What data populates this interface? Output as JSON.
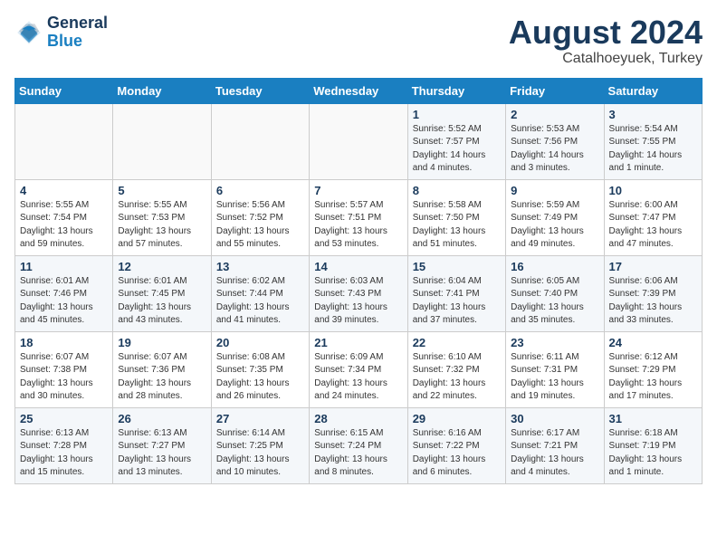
{
  "header": {
    "logo_line1": "General",
    "logo_line2": "Blue",
    "month_year": "August 2024",
    "location": "Catalhoeyuek, Turkey"
  },
  "weekdays": [
    "Sunday",
    "Monday",
    "Tuesday",
    "Wednesday",
    "Thursday",
    "Friday",
    "Saturday"
  ],
  "weeks": [
    [
      {
        "day": "",
        "info": ""
      },
      {
        "day": "",
        "info": ""
      },
      {
        "day": "",
        "info": ""
      },
      {
        "day": "",
        "info": ""
      },
      {
        "day": "1",
        "info": "Sunrise: 5:52 AM\nSunset: 7:57 PM\nDaylight: 14 hours\nand 4 minutes."
      },
      {
        "day": "2",
        "info": "Sunrise: 5:53 AM\nSunset: 7:56 PM\nDaylight: 14 hours\nand 3 minutes."
      },
      {
        "day": "3",
        "info": "Sunrise: 5:54 AM\nSunset: 7:55 PM\nDaylight: 14 hours\nand 1 minute."
      }
    ],
    [
      {
        "day": "4",
        "info": "Sunrise: 5:55 AM\nSunset: 7:54 PM\nDaylight: 13 hours\nand 59 minutes."
      },
      {
        "day": "5",
        "info": "Sunrise: 5:55 AM\nSunset: 7:53 PM\nDaylight: 13 hours\nand 57 minutes."
      },
      {
        "day": "6",
        "info": "Sunrise: 5:56 AM\nSunset: 7:52 PM\nDaylight: 13 hours\nand 55 minutes."
      },
      {
        "day": "7",
        "info": "Sunrise: 5:57 AM\nSunset: 7:51 PM\nDaylight: 13 hours\nand 53 minutes."
      },
      {
        "day": "8",
        "info": "Sunrise: 5:58 AM\nSunset: 7:50 PM\nDaylight: 13 hours\nand 51 minutes."
      },
      {
        "day": "9",
        "info": "Sunrise: 5:59 AM\nSunset: 7:49 PM\nDaylight: 13 hours\nand 49 minutes."
      },
      {
        "day": "10",
        "info": "Sunrise: 6:00 AM\nSunset: 7:47 PM\nDaylight: 13 hours\nand 47 minutes."
      }
    ],
    [
      {
        "day": "11",
        "info": "Sunrise: 6:01 AM\nSunset: 7:46 PM\nDaylight: 13 hours\nand 45 minutes."
      },
      {
        "day": "12",
        "info": "Sunrise: 6:01 AM\nSunset: 7:45 PM\nDaylight: 13 hours\nand 43 minutes."
      },
      {
        "day": "13",
        "info": "Sunrise: 6:02 AM\nSunset: 7:44 PM\nDaylight: 13 hours\nand 41 minutes."
      },
      {
        "day": "14",
        "info": "Sunrise: 6:03 AM\nSunset: 7:43 PM\nDaylight: 13 hours\nand 39 minutes."
      },
      {
        "day": "15",
        "info": "Sunrise: 6:04 AM\nSunset: 7:41 PM\nDaylight: 13 hours\nand 37 minutes."
      },
      {
        "day": "16",
        "info": "Sunrise: 6:05 AM\nSunset: 7:40 PM\nDaylight: 13 hours\nand 35 minutes."
      },
      {
        "day": "17",
        "info": "Sunrise: 6:06 AM\nSunset: 7:39 PM\nDaylight: 13 hours\nand 33 minutes."
      }
    ],
    [
      {
        "day": "18",
        "info": "Sunrise: 6:07 AM\nSunset: 7:38 PM\nDaylight: 13 hours\nand 30 minutes."
      },
      {
        "day": "19",
        "info": "Sunrise: 6:07 AM\nSunset: 7:36 PM\nDaylight: 13 hours\nand 28 minutes."
      },
      {
        "day": "20",
        "info": "Sunrise: 6:08 AM\nSunset: 7:35 PM\nDaylight: 13 hours\nand 26 minutes."
      },
      {
        "day": "21",
        "info": "Sunrise: 6:09 AM\nSunset: 7:34 PM\nDaylight: 13 hours\nand 24 minutes."
      },
      {
        "day": "22",
        "info": "Sunrise: 6:10 AM\nSunset: 7:32 PM\nDaylight: 13 hours\nand 22 minutes."
      },
      {
        "day": "23",
        "info": "Sunrise: 6:11 AM\nSunset: 7:31 PM\nDaylight: 13 hours\nand 19 minutes."
      },
      {
        "day": "24",
        "info": "Sunrise: 6:12 AM\nSunset: 7:29 PM\nDaylight: 13 hours\nand 17 minutes."
      }
    ],
    [
      {
        "day": "25",
        "info": "Sunrise: 6:13 AM\nSunset: 7:28 PM\nDaylight: 13 hours\nand 15 minutes."
      },
      {
        "day": "26",
        "info": "Sunrise: 6:13 AM\nSunset: 7:27 PM\nDaylight: 13 hours\nand 13 minutes."
      },
      {
        "day": "27",
        "info": "Sunrise: 6:14 AM\nSunset: 7:25 PM\nDaylight: 13 hours\nand 10 minutes."
      },
      {
        "day": "28",
        "info": "Sunrise: 6:15 AM\nSunset: 7:24 PM\nDaylight: 13 hours\nand 8 minutes."
      },
      {
        "day": "29",
        "info": "Sunrise: 6:16 AM\nSunset: 7:22 PM\nDaylight: 13 hours\nand 6 minutes."
      },
      {
        "day": "30",
        "info": "Sunrise: 6:17 AM\nSunset: 7:21 PM\nDaylight: 13 hours\nand 4 minutes."
      },
      {
        "day": "31",
        "info": "Sunrise: 6:18 AM\nSunset: 7:19 PM\nDaylight: 13 hours\nand 1 minute."
      }
    ]
  ]
}
